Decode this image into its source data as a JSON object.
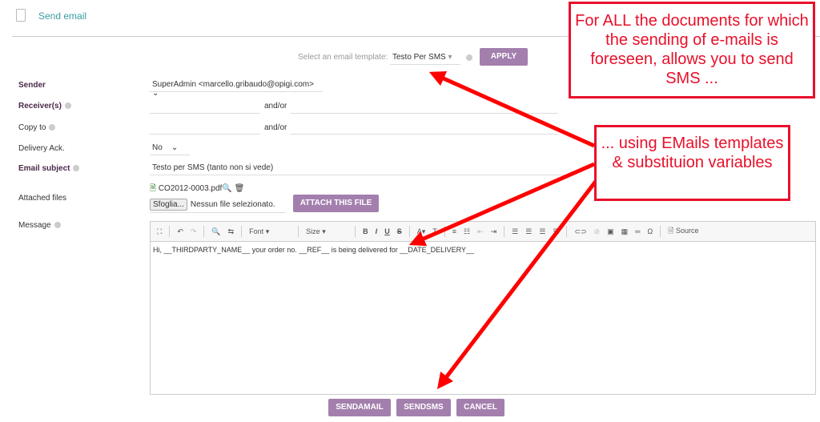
{
  "header": {
    "title": "Send email"
  },
  "template": {
    "label": "Select an email template:",
    "value": "Testo Per SMS",
    "apply": "APPLY"
  },
  "form": {
    "sender": {
      "label": "Sender",
      "value": "SuperAdmin <marcello.gribaudo@opigi.com>"
    },
    "receivers": {
      "label": "Receiver(s)",
      "andor": "and/or"
    },
    "copy_to": {
      "label": "Copy to",
      "andor": "and/or"
    },
    "delivery_ack": {
      "label": "Delivery Ack.",
      "value": "No"
    },
    "subject": {
      "label": "Email subject",
      "value": "Testo per SMS (tanto non si vede)"
    },
    "attached": {
      "label": "Attached files",
      "file": "CO2012-0003.pdf",
      "browse": "Sfoglia...",
      "no_file": "Nessun file selezionato.",
      "attach": "ATTACH THIS FILE"
    },
    "message": {
      "label": "Message",
      "font": "Font",
      "size": "Size",
      "source": "Source",
      "body": "Hi, __THIRDPARTY_NAME__ your order no. __REF__ is being delivered for __DATE_DELIVERY__"
    }
  },
  "buttons": {
    "sendmail": "SENDAMAIL",
    "sendsms": "SENDSMS",
    "cancel": "CANCEL"
  },
  "annotations": {
    "box1": "For ALL the documents for which the sending of e-mails is foreseen, allows you to send SMS ...",
    "box2": "... using EMails templates & substituion variables"
  },
  "colors": {
    "accent": "#a37fae",
    "annotation": "#e8102a"
  }
}
